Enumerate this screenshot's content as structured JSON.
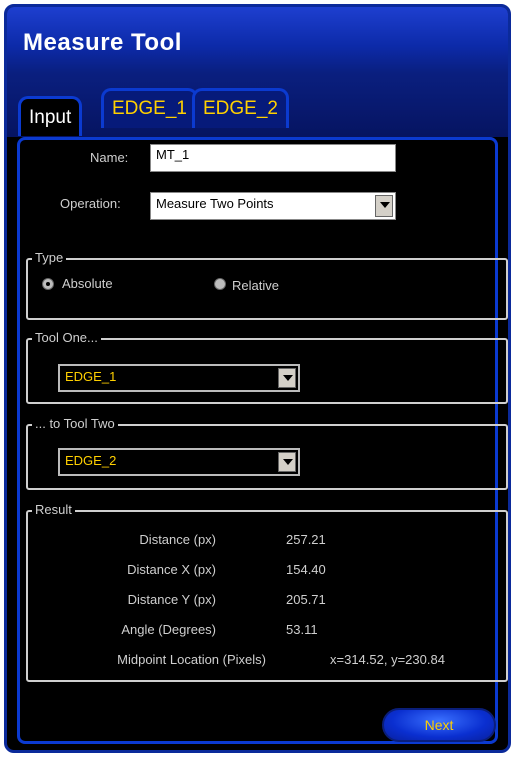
{
  "window": {
    "title": "Measure Tool"
  },
  "tabs": [
    {
      "label": "Input",
      "active": true
    },
    {
      "label": "EDGE_1",
      "active": false
    },
    {
      "label": "EDGE_2",
      "active": false
    }
  ],
  "form": {
    "name_label": "Name:",
    "name_value": "MT_1",
    "operation_label": "Operation:",
    "operation_value": "Measure Two Points"
  },
  "type_group": {
    "legend": "Type",
    "options": [
      {
        "label": "Absolute",
        "selected": true
      },
      {
        "label": "Relative",
        "selected": false
      }
    ]
  },
  "tool_one": {
    "legend": "Tool One...",
    "value": "EDGE_1"
  },
  "tool_two": {
    "legend": "... to Tool Two",
    "value": "EDGE_2"
  },
  "result": {
    "legend": "Result",
    "rows": [
      {
        "name": "Distance  (px)",
        "value": "257.21"
      },
      {
        "name": "Distance X  (px)",
        "value": "154.40"
      },
      {
        "name": "Distance Y  (px)",
        "value": "205.71"
      },
      {
        "name": "Angle (Degrees)",
        "value": "53.11"
      },
      {
        "name": "Midpoint Location (Pixels)",
        "value": "x=314.52, y=230.84"
      }
    ]
  },
  "buttons": {
    "next_label": "Next"
  },
  "colors": {
    "accent": "#0b3ad0",
    "tab_text": "#ffd000",
    "background": "#000000"
  }
}
